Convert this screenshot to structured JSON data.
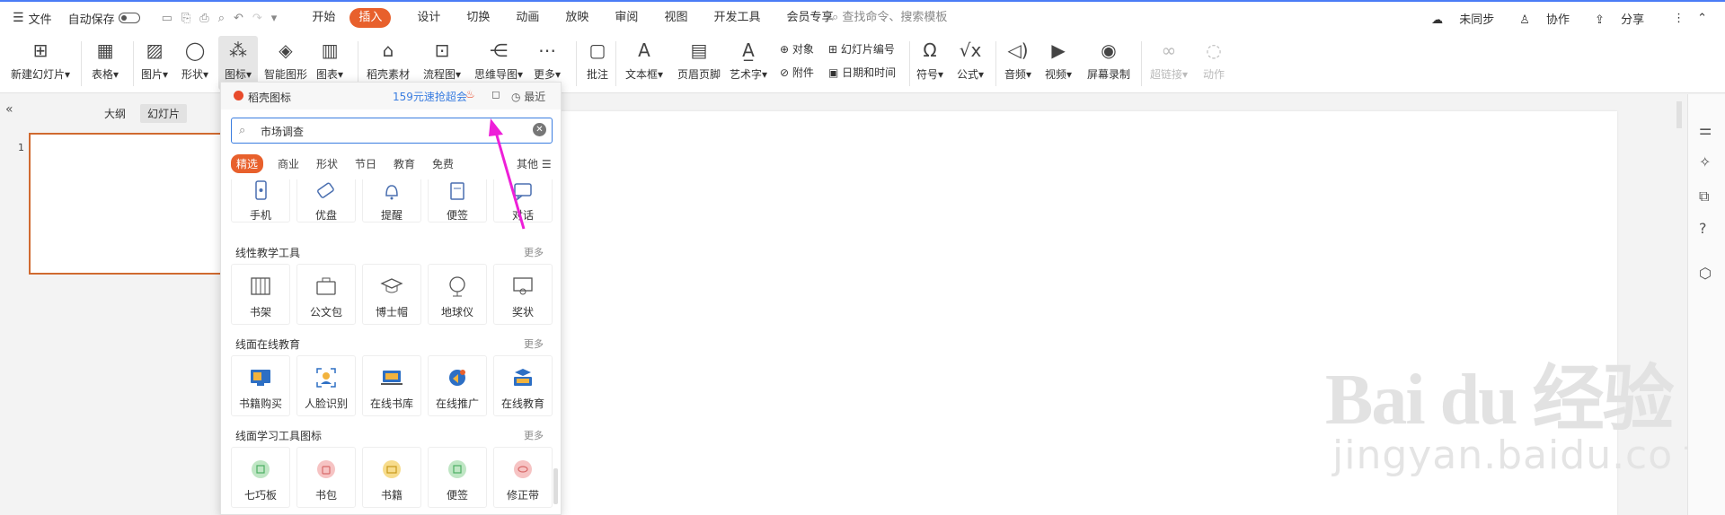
{
  "menu": {
    "file": "文件",
    "autosave": "自动保存",
    "tabs": [
      "开始",
      "插入",
      "设计",
      "切换",
      "动画",
      "放映",
      "审阅",
      "视图",
      "开发工具",
      "会员专享"
    ],
    "active_tab": 1,
    "search_placeholder": "查找命令、搜索模板",
    "right": {
      "sync": "未同步",
      "collab": "协作",
      "share": "分享"
    }
  },
  "ribbon": {
    "new_slide": "新建幻灯片",
    "table": "表格",
    "picture": "图片",
    "shape": "形状",
    "icon": "图标",
    "smartart": "智能图形",
    "chart": "图表",
    "material": "稻壳素材",
    "flowchart": "流程图",
    "mindmap": "思维导图",
    "more": "更多",
    "comment": "批注",
    "textbox": "文本框",
    "headerfooter": "页眉页脚",
    "wordart": "艺术字",
    "object": "对象",
    "attachment": "附件",
    "slide_number": "幻灯片编号",
    "datetime": "日期和时间",
    "symbol": "符号",
    "formula": "公式",
    "audio": "音频",
    "video": "视频",
    "screenrec": "屏幕录制",
    "hyperlink": "超链接",
    "action": "动作"
  },
  "left_panel": {
    "outline": "大纲",
    "slides": "幻灯片",
    "slide_number": "1"
  },
  "popup": {
    "title": "稻壳图标",
    "promo": "159元速抢超会",
    "recent": "最近",
    "search_value": "市场调查",
    "tabs": [
      "精选",
      "商业",
      "形状",
      "节日",
      "教育",
      "免费",
      "其他"
    ],
    "more_label": "更多",
    "top_row": [
      "手机",
      "优盘",
      "提醒",
      "便签",
      "对话"
    ],
    "sections": [
      {
        "title": "线性教学工具",
        "items": [
          "书架",
          "公文包",
          "博士帽",
          "地球仪",
          "奖状"
        ]
      },
      {
        "title": "线面在线教育",
        "items": [
          "书籍购买",
          "人脸识别",
          "在线书库",
          "在线推广",
          "在线教育"
        ]
      },
      {
        "title": "线面学习工具图标",
        "items": [
          "七巧板",
          "书包",
          "书籍",
          "便签",
          "修正带"
        ]
      }
    ]
  },
  "watermark": {
    "brand": "Bai du 经验",
    "url": "jingyan.baidu.com"
  },
  "colors": {
    "accent": "#e8602c",
    "link": "#3a7de0",
    "arrow": "#ee1fd8",
    "thumb_border": "#d06a30"
  }
}
